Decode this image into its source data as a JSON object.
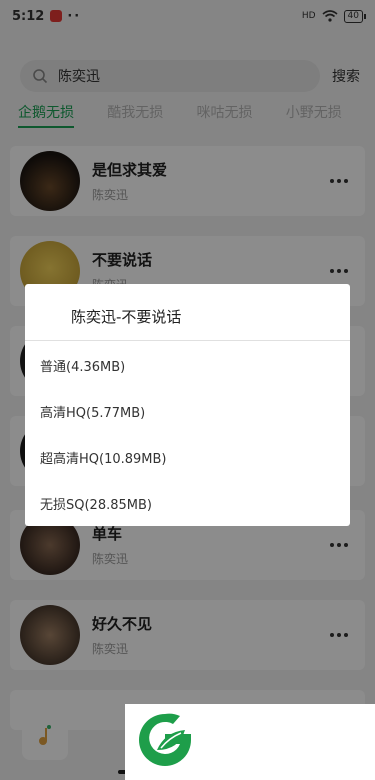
{
  "status_bar": {
    "time": "5:12",
    "dots": "··",
    "signal": "HD",
    "battery": "40"
  },
  "search": {
    "query": "陈奕迅",
    "placeholder": "",
    "button_label": "搜索"
  },
  "tabs": [
    {
      "label": "企鹅无损",
      "active": true
    },
    {
      "label": "酷我无损",
      "active": false
    },
    {
      "label": "咪咕无损",
      "active": false
    },
    {
      "label": "小野无损",
      "active": false
    }
  ],
  "songs": [
    {
      "title": "是但求其爱",
      "artist": "陈奕迅"
    },
    {
      "title": "不要说话",
      "artist": "陈奕迅"
    },
    {
      "title": "",
      "artist": ""
    },
    {
      "title": "",
      "artist": ""
    },
    {
      "title": "单车",
      "artist": "陈奕迅"
    },
    {
      "title": "好久不见",
      "artist": "陈奕迅"
    }
  ],
  "dialog": {
    "title": "陈奕迅-不要说话",
    "options": [
      "普通(4.36MB)",
      "高清HQ(5.77MB)",
      "超高清HQ(10.89MB)",
      "无损SQ(28.85MB)"
    ]
  },
  "colors": {
    "accent": "#1aa054",
    "overlay": "rgba(0,0,0,0.45)",
    "watermark_green": "#1e9e4a"
  },
  "icons": {
    "search": "search-icon",
    "more": "more-icon",
    "wifi": "wifi-icon",
    "player": "music-note-icon",
    "watermark": "leaf-logo"
  }
}
